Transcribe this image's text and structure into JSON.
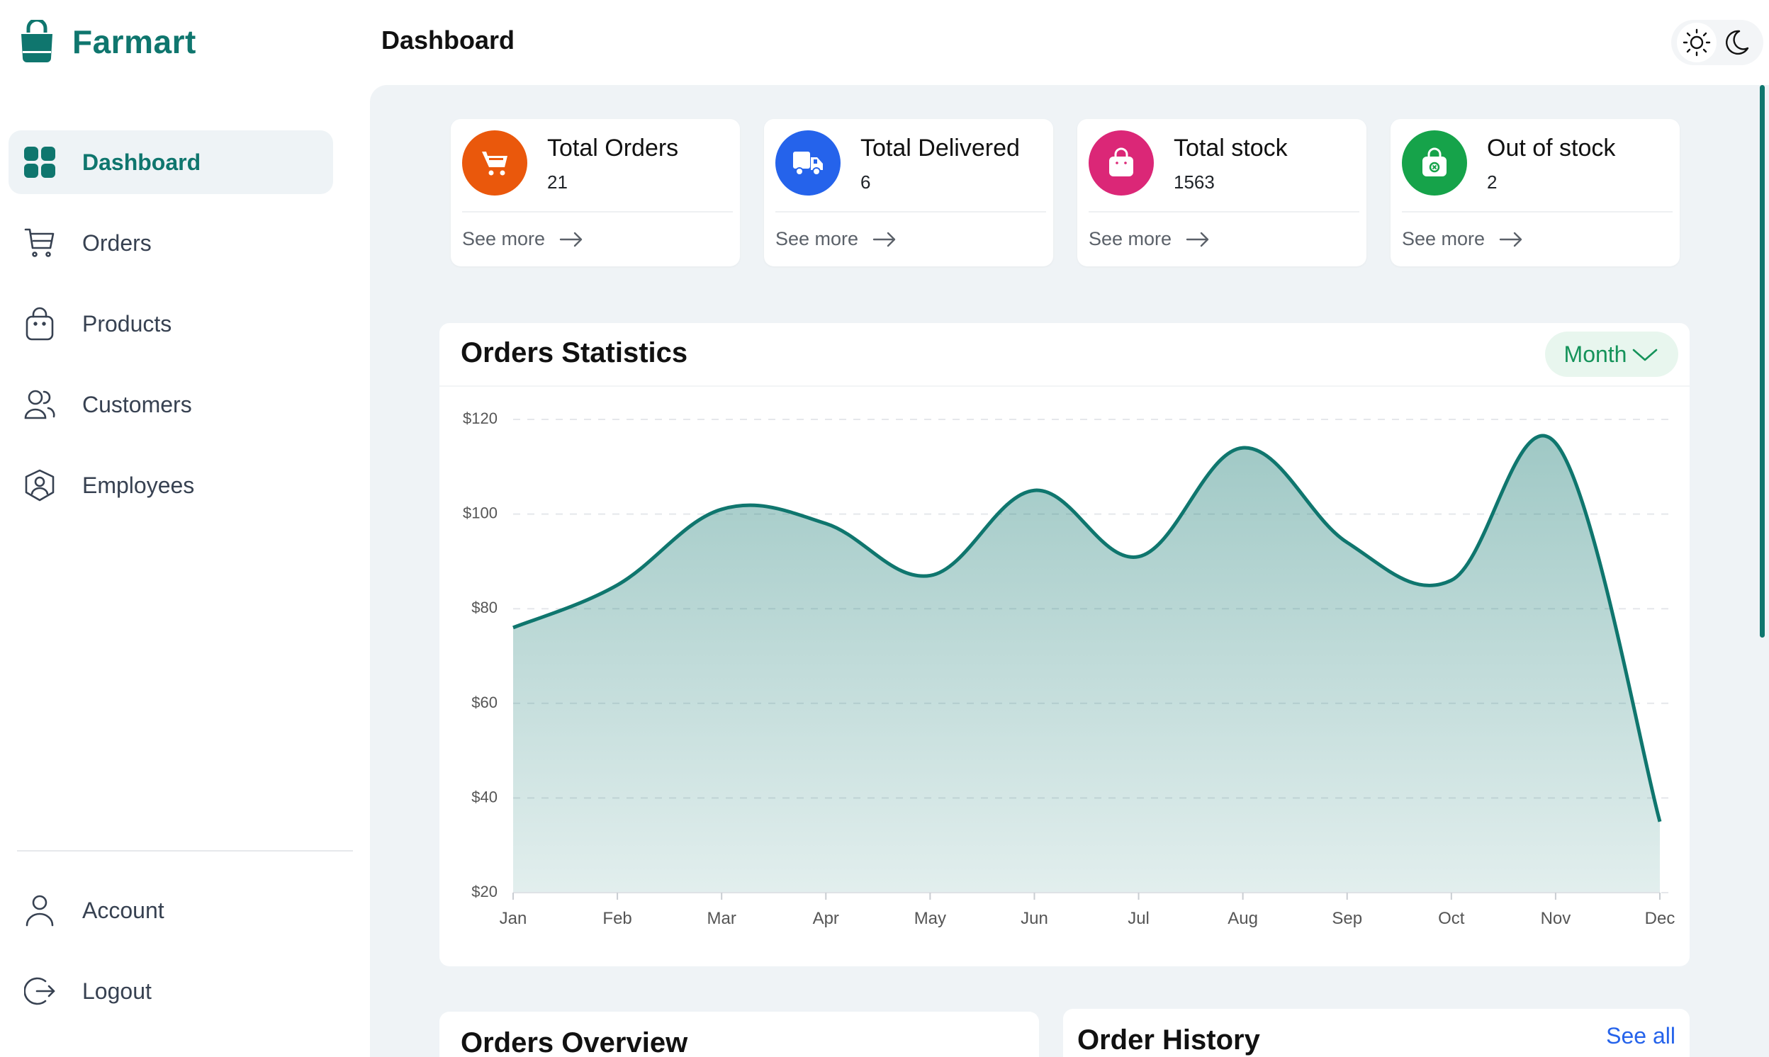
{
  "brand": {
    "name": "Farmart"
  },
  "header": {
    "title": "Dashboard"
  },
  "theme": {
    "options": [
      "sun-icon",
      "moon-icon"
    ],
    "selected": "light"
  },
  "sidebar": {
    "items": [
      {
        "label": "Dashboard",
        "icon": "dashboard-icon",
        "active": true
      },
      {
        "label": "Orders",
        "icon": "cart-icon"
      },
      {
        "label": "Products",
        "icon": "bag-icon"
      },
      {
        "label": "Customers",
        "icon": "users-icon"
      },
      {
        "label": "Employees",
        "icon": "employee-icon"
      }
    ],
    "bottom": [
      {
        "label": "Account",
        "icon": "user-icon"
      },
      {
        "label": "Logout",
        "icon": "logout-icon"
      }
    ]
  },
  "cards": [
    {
      "title": "Total Orders",
      "value": "21",
      "link": "See more",
      "color": "#ea580c",
      "icon": "cart-icon"
    },
    {
      "title": "Total Delivered",
      "value": "6",
      "link": "See more",
      "color": "#2563eb",
      "icon": "truck-icon"
    },
    {
      "title": "Total stock",
      "value": "1563",
      "link": "See more",
      "color": "#db2777",
      "icon": "bag-icon"
    },
    {
      "title": "Out of stock",
      "value": "2",
      "link": "See more",
      "color": "#16a34a",
      "icon": "bag-x-icon"
    }
  ],
  "stats": {
    "title": "Orders Statistics",
    "period": "Month"
  },
  "chart_data": {
    "type": "area",
    "categories": [
      "Jan",
      "Feb",
      "Mar",
      "Apr",
      "May",
      "Jun",
      "Jul",
      "Aug",
      "Sep",
      "Oct",
      "Nov",
      "Dec"
    ],
    "series": [
      {
        "values": [
          76,
          85,
          101,
          98,
          87,
          105,
          91,
          114,
          94,
          86,
          115,
          35
        ]
      }
    ],
    "y_ticks": [
      "$20",
      "$40",
      "$60",
      "$80",
      "$100",
      "$120"
    ],
    "ylim": [
      20,
      120
    ],
    "grid": "dashed horizontal",
    "color": "#0f766e"
  },
  "panels": {
    "overview_title": "Orders Overview",
    "history_title": "Order History",
    "history_link": "See all"
  }
}
